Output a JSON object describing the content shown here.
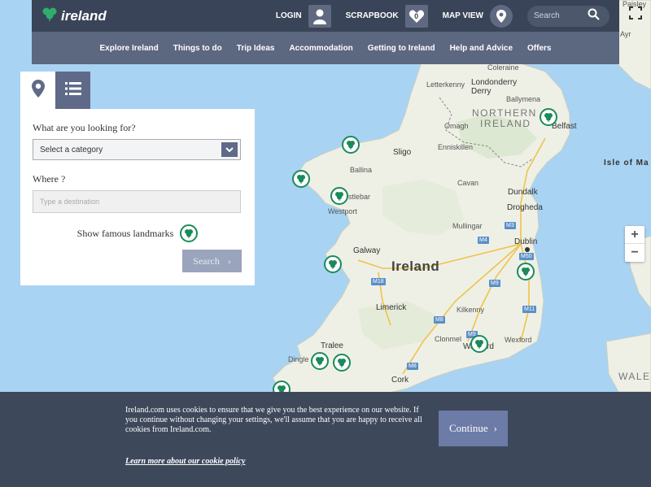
{
  "header": {
    "logo_text": "ireland",
    "login_label": "LOGIN",
    "scrapbook_label": "SCRAPBOOK",
    "scrapbook_count": "0",
    "map_view_label": "MAP VIEW",
    "search_placeholder": "Search"
  },
  "nav": {
    "items": [
      {
        "label": "Explore Ireland"
      },
      {
        "label": "Things to do"
      },
      {
        "label": "Trip Ideas"
      },
      {
        "label": "Accommodation"
      },
      {
        "label": "Getting to Ireland"
      },
      {
        "label": "Help and Advice"
      },
      {
        "label": "Offers"
      }
    ]
  },
  "panel": {
    "looking_for_label": "What are you looking for?",
    "category_value": "Select a category",
    "where_label": "Where ?",
    "destination_placeholder": "Type a destination",
    "landmarks_label": "Show famous landmarks",
    "search_button": "Search"
  },
  "map": {
    "places": {
      "coleraine": "Coleraine",
      "letterkenny": "Letterkenny",
      "londonderry": "Londonderry",
      "derry": "Derry",
      "ballymena": "Ballymena",
      "northern": "NORTHERN",
      "ireland_region": "IRELAND",
      "belfast": "Belfast",
      "omagh": "Omagh",
      "enniskillen": "Enniskillen",
      "sligo": "Sligo",
      "ballina": "Ballina",
      "castlebar": "stlebar",
      "westport": "Westport",
      "cavan": "Cavan",
      "dundalk": "Dundalk",
      "drogheda": "Drogheda",
      "mullingar": "Mullingar",
      "dublin": "Dublin",
      "galway": "Galway",
      "country": "Ireland",
      "limerick": "Limerick",
      "kilkenny": "Kilkenny",
      "clonmel": "Clonmel",
      "waterford": "Wa    rford",
      "wexford": "Wexford",
      "tralee": "Tralee",
      "dingle": "Dingle",
      "cork": "Cork",
      "isle_of_man": "Isle of Ma",
      "wales": "WALE",
      "ayr": "Ayr",
      "paisley": "Paisley"
    },
    "roads": {
      "m3": "M3",
      "m4": "M4",
      "m50": "M50",
      "m18": "M18",
      "m9a": "M9",
      "m11": "M11",
      "m8a": "M8",
      "m9b": "M9",
      "m8b": "M8"
    },
    "zoom_in": "+",
    "zoom_out": "−"
  },
  "cookie": {
    "text": "Ireland.com uses cookies to ensure that we give you the best experience on our website. If you continue without changing your settings, we'll assume that you are happy to receive all cookies from Ireland.com.",
    "link": "Learn more about our cookie policy",
    "continue_label": "Continue"
  },
  "colors": {
    "header_dark": "#3a4458",
    "nav_bar": "#5c6780",
    "accent_green": "#1b8a5a",
    "cookie_bg": "#3e485b",
    "continue_btn": "#6d7ba7",
    "sea": "#a9d3f3",
    "land": "#eef0e6"
  }
}
